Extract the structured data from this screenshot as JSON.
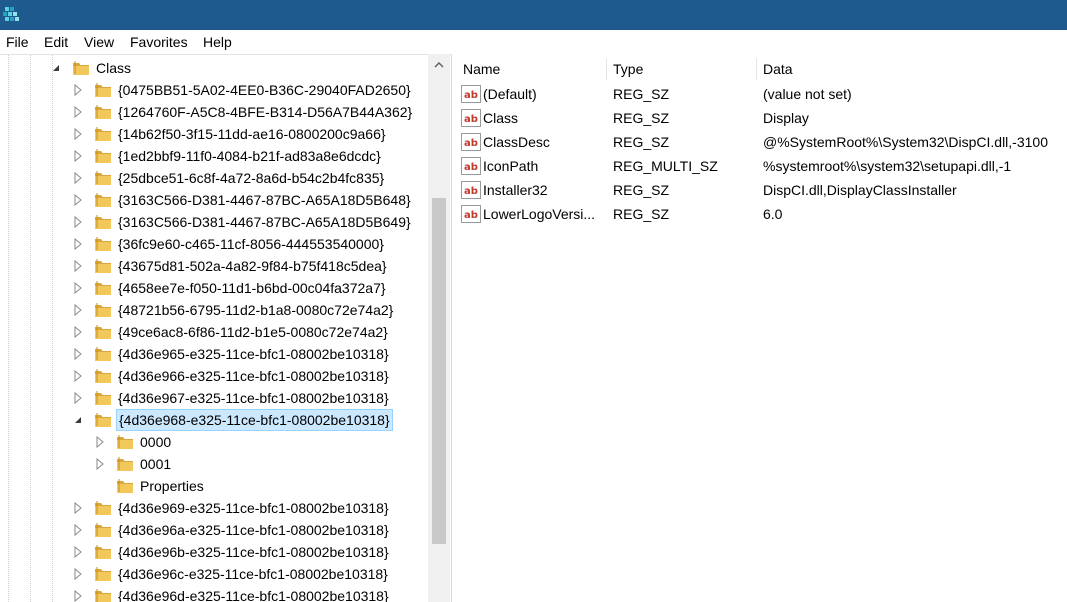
{
  "menubar": {
    "items": [
      "File",
      "Edit",
      "View",
      "Favorites",
      "Help"
    ]
  },
  "tree": {
    "root_label": "Class",
    "keys_before": [
      "{0475BB51-5A02-4EE0-B36C-29040FAD2650}",
      "{1264760F-A5C8-4BFE-B314-D56A7B44A362}",
      "{14b62f50-3f15-11dd-ae16-0800200c9a66}",
      "{1ed2bbf9-11f0-4084-b21f-ad83a8e6dcdc}",
      "{25dbce51-6c8f-4a72-8a6d-b54c2b4fc835}",
      "{3163C566-D381-4467-87BC-A65A18D5B648}",
      "{3163C566-D381-4467-87BC-A65A18D5B649}",
      "{36fc9e60-c465-11cf-8056-444553540000}",
      "{43675d81-502a-4a82-9f84-b75f418c5dea}",
      "{4658ee7e-f050-11d1-b6bd-00c04fa372a7}",
      "{48721b56-6795-11d2-b1a8-0080c72e74a2}",
      "{49ce6ac8-6f86-11d2-b1e5-0080c72e74a2}",
      "{4d36e965-e325-11ce-bfc1-08002be10318}",
      "{4d36e966-e325-11ce-bfc1-08002be10318}",
      "{4d36e967-e325-11ce-bfc1-08002be10318}"
    ],
    "selected_key": "{4d36e968-e325-11ce-bfc1-08002be10318}",
    "children": [
      "0000",
      "0001",
      "Properties"
    ],
    "keys_after": [
      "{4d36e969-e325-11ce-bfc1-08002be10318}",
      "{4d36e96a-e325-11ce-bfc1-08002be10318}",
      "{4d36e96b-e325-11ce-bfc1-08002be10318}",
      "{4d36e96c-e325-11ce-bfc1-08002be10318}",
      "{4d36e96d-e325-11ce-bfc1-08002be10318}"
    ]
  },
  "values": {
    "headers": {
      "name": "Name",
      "type": "Type",
      "data": "Data"
    },
    "rows": [
      {
        "name": "(Default)",
        "type": "REG_SZ",
        "data": "(value not set)"
      },
      {
        "name": "Class",
        "type": "REG_SZ",
        "data": "Display"
      },
      {
        "name": "ClassDesc",
        "type": "REG_SZ",
        "data": "@%SystemRoot%\\System32\\DispCI.dll,-3100"
      },
      {
        "name": "IconPath",
        "type": "REG_MULTI_SZ",
        "data": "%systemroot%\\system32\\setupapi.dll,-1"
      },
      {
        "name": "Installer32",
        "type": "REG_SZ",
        "data": "DispCI.dll,DisplayClassInstaller"
      },
      {
        "name": "LowerLogoVersi...",
        "type": "REG_SZ",
        "data": "6.0"
      }
    ]
  },
  "colors": {
    "titlebar": "#1f5a8f",
    "selection_fill": "#cce8ff",
    "selection_border": "#99d1ff",
    "folder": "#e8b94a"
  },
  "icons": {
    "app": "regedit-icon",
    "folder": "folder-icon",
    "value": "string-value-icon",
    "expand": "triangle-right-icon",
    "collapse": "triangle-down-icon"
  }
}
